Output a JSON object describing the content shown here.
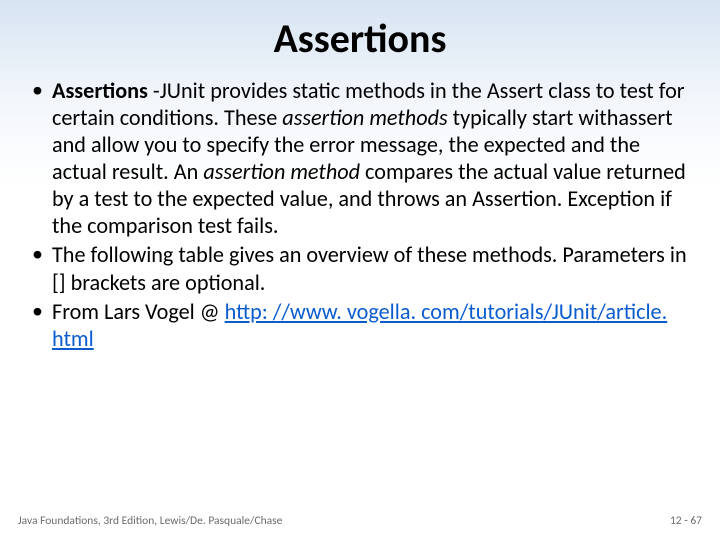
{
  "title": "Assertions",
  "bullets": [
    {
      "parts": [
        {
          "text": "Assertions",
          "cls": "bold"
        },
        {
          "text": " -JUnit provides static methods in the "
        },
        {
          "text": "Assert class to test for certain conditions. These "
        },
        {
          "text": "assertion methods",
          "cls": "italic"
        },
        {
          "text": " typically start withassert and allow you to specify the error message, the expected and the actual result. An "
        },
        {
          "text": "assertion method",
          "cls": "italic"
        },
        {
          "text": " compares the actual value returned by a test to the expected value, and throws an Assertion. Exception if the comparison test fails."
        }
      ]
    },
    {
      "parts": [
        {
          "text": "The following table gives an overview of these methods. Parameters in [] brackets are optional."
        }
      ]
    },
    {
      "parts": [
        {
          "text": "From Lars Vogel @ "
        },
        {
          "text": "http: //www. vogella. com/tutorials/JUnit/article. html",
          "cls": "link"
        }
      ]
    }
  ],
  "footer": {
    "left": "Java Foundations, 3rd Edition, Lewis/De. Pasquale/Chase",
    "right": "12 - 67"
  }
}
